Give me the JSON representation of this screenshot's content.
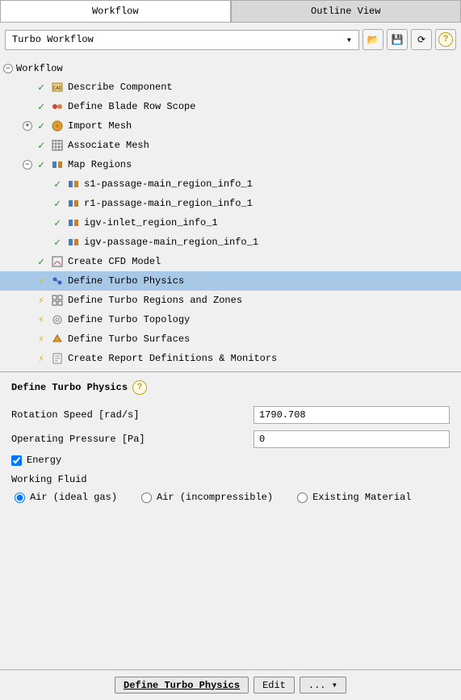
{
  "tabs": {
    "workflow": "Workflow",
    "outline": "Outline View"
  },
  "dropdown": {
    "selected": "Turbo Workflow"
  },
  "tree": {
    "root": "Workflow",
    "items": [
      {
        "label": "Describe Component",
        "status": "check",
        "icon": "describe",
        "indent": 1
      },
      {
        "label": "Define Blade Row Scope",
        "status": "check",
        "icon": "blade",
        "indent": 1
      },
      {
        "label": "Import Mesh",
        "status": "check",
        "icon": "import",
        "indent": 1,
        "expand": "plus"
      },
      {
        "label": "Associate Mesh",
        "status": "check",
        "icon": "associate",
        "indent": 1
      },
      {
        "label": "Map Regions",
        "status": "check",
        "icon": "map",
        "indent": 1,
        "expand": "minus"
      },
      {
        "label": "s1-passage-main_region_info_1",
        "status": "check",
        "icon": "region",
        "indent": 2
      },
      {
        "label": "r1-passage-main_region_info_1",
        "status": "check",
        "icon": "region",
        "indent": 2
      },
      {
        "label": "igv-inlet_region_info_1",
        "status": "check",
        "icon": "region",
        "indent": 2
      },
      {
        "label": "igv-passage-main_region_info_1",
        "status": "check",
        "icon": "region",
        "indent": 2
      },
      {
        "label": "Create CFD Model",
        "status": "check",
        "icon": "cfd",
        "indent": 1
      },
      {
        "label": "Define Turbo Physics",
        "status": "bolt",
        "icon": "physics",
        "indent": 1,
        "selected": true
      },
      {
        "label": "Define Turbo Regions and Zones",
        "status": "bolt",
        "icon": "zones",
        "indent": 1
      },
      {
        "label": "Define Turbo Topology",
        "status": "bolt",
        "icon": "topology",
        "indent": 1
      },
      {
        "label": "Define Turbo Surfaces",
        "status": "bolt",
        "icon": "surfaces",
        "indent": 1
      },
      {
        "label": "Create Report Definitions & Monitors",
        "status": "bolt",
        "icon": "report",
        "indent": 1
      }
    ]
  },
  "panel": {
    "title": "Define Turbo Physics",
    "rotation_label": "Rotation Speed [rad/s]",
    "rotation_value": "1790.708",
    "pressure_label": "Operating Pressure [Pa]",
    "pressure_value": "0",
    "energy_label": "Energy",
    "energy_checked": true,
    "fluid_label": "Working Fluid",
    "radios": {
      "air_ideal": "Air (ideal gas)",
      "air_incomp": "Air (incompressible)",
      "existing": "Existing Material"
    },
    "radio_selected": "air_ideal"
  },
  "buttons": {
    "define": "Define Turbo Physics",
    "edit": "Edit",
    "more": "..."
  }
}
